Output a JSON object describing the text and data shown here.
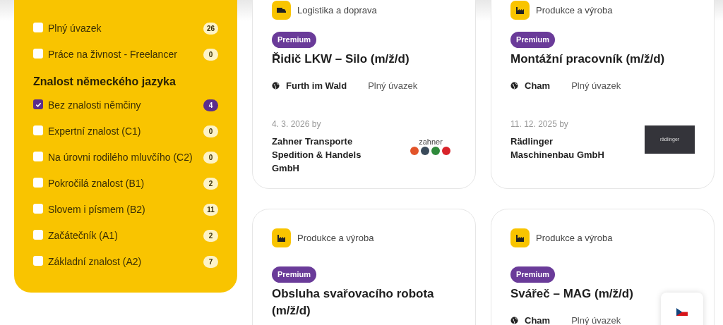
{
  "filters": {
    "employment_items": [
      {
        "label": "Plný úvazek",
        "count": "26",
        "checked": false
      },
      {
        "label": "Práce na živnost - Freelancer",
        "count": "0",
        "checked": false
      }
    ],
    "language_heading": "Znalost německého jazyka",
    "language_items": [
      {
        "label": "Bez znalosti němčiny",
        "count": "4",
        "checked": true
      },
      {
        "label": "Expertní znalost (C1)",
        "count": "0",
        "checked": false
      },
      {
        "label": "Na úrovni rodilého mluvčího (C2)",
        "count": "0",
        "checked": false
      },
      {
        "label": "Pokročilá znalost (B1)",
        "count": "2",
        "checked": false
      },
      {
        "label": "Slovem i písmem (B2)",
        "count": "11",
        "checked": false
      },
      {
        "label": "Začátečník (A1)",
        "count": "2",
        "checked": false
      },
      {
        "label": "Základní znalost (A2)",
        "count": "7",
        "checked": false
      }
    ]
  },
  "jobs": [
    {
      "category": "Logistika a doprava",
      "kind": "truck",
      "badge": "Premium",
      "title": "Řidič LKW – Silo (m/ž/d)",
      "location": "Furth im Wald",
      "employment": "Plný úvazek",
      "date": "4. 3. 2026 by",
      "company": "Zahner Transporte Spedition & Handels GmbH",
      "logo": {
        "kind": "zahner",
        "text": "zahner"
      }
    },
    {
      "category": "Produkce a výroba",
      "kind": "factory",
      "badge": "Premium",
      "title": "Montážní pracovník (m/ž/d)",
      "location": "Cham",
      "employment": "Plný úvazek",
      "date": "11. 12. 2025 by",
      "company": "Rädlinger Maschinenbau GmbH",
      "logo": {
        "kind": "dark",
        "text": "rädlinger"
      }
    },
    {
      "category": "Produkce a výroba",
      "kind": "factory",
      "badge": "Premium",
      "title": "Obsluha svařovacího robota (m/ž/d)"
    },
    {
      "category": "Produkce a výroba",
      "kind": "factory",
      "badge": "Premium",
      "title": "Svářeč – MAG (m/ž/d)",
      "location": "Cham",
      "employment": "Plný úvazek"
    }
  ]
}
